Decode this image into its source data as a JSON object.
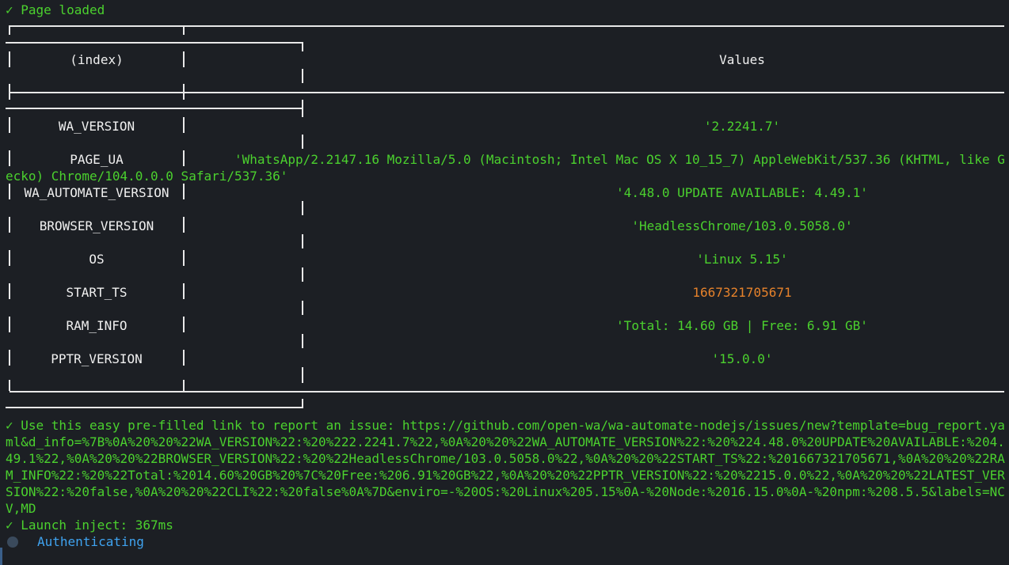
{
  "status": {
    "page_loaded": "✓ Page loaded",
    "launch_inject": "✓ Launch inject: 367ms",
    "authenticating": "Authenticating"
  },
  "table": {
    "headers": {
      "index": "(index)",
      "values": "Values"
    },
    "rows": [
      {
        "key": "WA_VERSION",
        "value": "'2.2241.7'",
        "kind": "string"
      },
      {
        "key": "PAGE_UA",
        "value": "'WhatsApp/2.2147.16 Mozilla/5.0 (Macintosh; Intel Mac OS X 10_15_7) AppleWebKit/537.36 (KHTML, like Gecko) Chrome/104.0.0.0 Safari/537.36'",
        "kind": "string"
      },
      {
        "key": "WA_AUTOMATE_VERSION",
        "value": "'4.48.0 UPDATE AVAILABLE: 4.49.1'",
        "kind": "string"
      },
      {
        "key": "BROWSER_VERSION",
        "value": "'HeadlessChrome/103.0.5058.0'",
        "kind": "string"
      },
      {
        "key": "OS",
        "value": "'Linux 5.15'",
        "kind": "string"
      },
      {
        "key": "START_TS",
        "value": "1667321705671",
        "kind": "number"
      },
      {
        "key": "RAM_INFO",
        "value": "'Total: 14.60 GB | Free: 6.91 GB'",
        "kind": "string"
      },
      {
        "key": "PPTR_VERSION",
        "value": "'15.0.0'",
        "kind": "string"
      }
    ]
  },
  "issue_link": "✓ Use this easy pre-filled link to report an issue: https://github.com/open-wa/wa-automate-nodejs/issues/new?template=bug_report.yaml&d_info=%7B%0A%20%20%22WA_VERSION%22:%20%222.2241.7%22,%0A%20%20%22WA_AUTOMATE_VERSION%22:%20%224.48.0%20UPDATE%20AVAILABLE:%204.49.1%22,%0A%20%20%22BROWSER_VERSION%22:%20%22HeadlessChrome/103.0.5058.0%22,%0A%20%20%22START_TS%22:%201667321705671,%0A%20%20%22RAM_INFO%22:%20%22Total:%2014.60%20GB%20%7C%20Free:%206.91%20GB%22,%0A%20%20%22PPTR_VERSION%22:%20%2215.0.0%22,%0A%20%20%22LATEST_VERSION%22:%20false,%0A%20%20%22CLI%22:%20false%0A%7D&enviro=-%20OS:%20Linux%205.15%0A-%20Node:%2016.15.0%0A-%20npm:%208.5.5&labels=NCV,MD",
  "colors": {
    "background": "#1c1f24",
    "text": "#e8e8e8",
    "success": "#4bd12e",
    "number": "#e6822b",
    "info": "#3fa3f0"
  },
  "icons": {
    "spinner": "spinner-icon"
  }
}
